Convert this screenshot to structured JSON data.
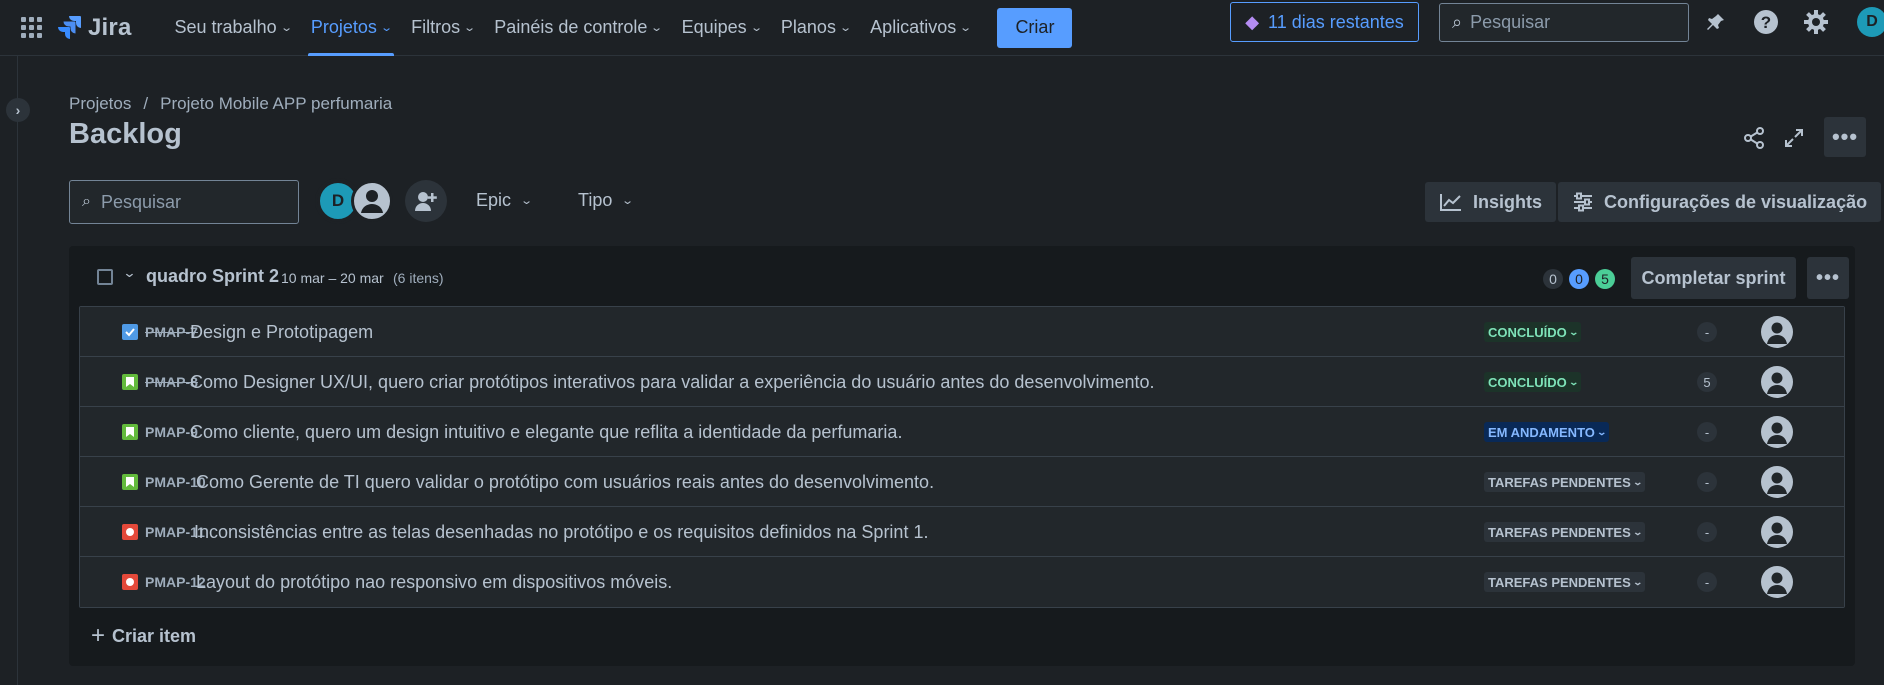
{
  "topnav": {
    "logo_text": "Jira",
    "items": [
      {
        "label": "Seu trabalho",
        "active": false
      },
      {
        "label": "Projetos",
        "active": true
      },
      {
        "label": "Filtros",
        "active": false
      },
      {
        "label": "Painéis de controle",
        "active": false
      },
      {
        "label": "Equipes",
        "active": false
      },
      {
        "label": "Planos",
        "active": false
      },
      {
        "label": "Aplicativos",
        "active": false
      }
    ],
    "create_label": "Criar",
    "trial_label": "11 dias restantes",
    "search_placeholder": "Pesquisar",
    "avatar_initial": "D",
    "accent_color": "#579dff"
  },
  "breadcrumb": {
    "root": "Projetos",
    "separator": "/",
    "project": "Projeto Mobile APP perfumaria"
  },
  "page_title": "Backlog",
  "filters": {
    "search_placeholder": "Pesquisar",
    "avatar_initial": "D",
    "epic_label": "Epic",
    "type_label": "Tipo",
    "insights_label": "Insights",
    "view_settings_label": "Configurações de visualização"
  },
  "sprint": {
    "name": "quadro Sprint 2",
    "dates": "10 mar – 20 mar",
    "count": "(6 itens)",
    "counts": {
      "todo": "0",
      "in_progress": "0",
      "done": "5"
    },
    "complete_label": "Completar sprint",
    "create_item_label": "Criar item",
    "rows": [
      {
        "type": "task",
        "key": "PMAP-7",
        "done": true,
        "summary": "Design e Prototipagem",
        "status": "CONCLUÍDO",
        "status_kind": "done",
        "points": "-"
      },
      {
        "type": "story",
        "key": "PMAP-8",
        "done": true,
        "summary": "Como Designer UX/UI, quero criar protótipos interativos para validar a experiência do usuário antes do desenvolvimento.",
        "status": "CONCLUÍDO",
        "status_kind": "done",
        "points": "5"
      },
      {
        "type": "story",
        "key": "PMAP-9",
        "done": false,
        "summary": "Como cliente, quero um design intuitivo e elegante que reflita a identidade da perfumaria.",
        "status": "EM ANDAMENTO",
        "status_kind": "prog",
        "points": "-"
      },
      {
        "type": "story",
        "key": "PMAP-10",
        "done": false,
        "summary": "Como Gerente de TI quero validar o protótipo com usuários reais antes do desenvolvimento.",
        "status": "TAREFAS PENDENTES",
        "status_kind": "todo",
        "points": "-"
      },
      {
        "type": "bug",
        "key": "PMAP-11",
        "done": false,
        "summary": "Inconsistências entre as telas desenhadas no protótipo e os requisitos definidos na Sprint 1.",
        "status": "TAREFAS PENDENTES",
        "status_kind": "todo",
        "points": "-"
      },
      {
        "type": "bug",
        "key": "PMAP-12",
        "done": false,
        "summary": "Layout do protótipo nao responsivo em dispositivos móveis.",
        "status": "TAREFAS PENDENTES",
        "status_kind": "todo",
        "points": "-"
      }
    ]
  }
}
